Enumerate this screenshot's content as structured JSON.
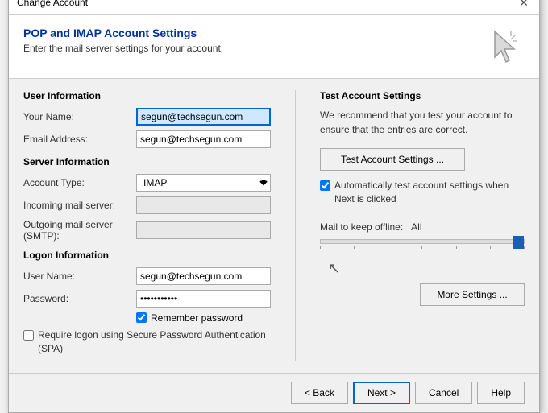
{
  "dialog": {
    "title": "Change Account",
    "close_label": "✕"
  },
  "header": {
    "title": "POP and IMAP Account Settings",
    "subtitle": "Enter the mail server settings for your account.",
    "icon_label": "cursor-icon"
  },
  "left": {
    "user_info_title": "User Information",
    "your_name_label": "Your Name:",
    "your_name_value": "segun@techsegun.com",
    "email_address_label": "Email Address:",
    "email_address_value": "segun@techsegun.com",
    "server_info_title": "Server Information",
    "account_type_label": "Account Type:",
    "account_type_value": "IMAP",
    "incoming_label": "Incoming mail server:",
    "incoming_value": "",
    "outgoing_label": "Outgoing mail server (SMTP):",
    "outgoing_value": "",
    "logon_info_title": "Logon Information",
    "username_label": "User Name:",
    "username_value": "segun@techsegun.com",
    "password_label": "Password:",
    "password_value": "••••••••",
    "remember_password_label": "Remember password",
    "require_spa_label": "Require logon using Secure Password Authentication (SPA)"
  },
  "right": {
    "title": "Test Account Settings",
    "description": "We recommend that you test your account to ensure that the entries are correct.",
    "test_btn_label": "Test Account Settings ...",
    "auto_test_label": "Automatically test account settings when Next is clicked",
    "offline_label": "Mail to keep offline:",
    "offline_value": "All",
    "more_settings_label": "More Settings ..."
  },
  "footer": {
    "back_label": "< Back",
    "next_label": "Next >",
    "cancel_label": "Cancel",
    "help_label": "Help"
  }
}
